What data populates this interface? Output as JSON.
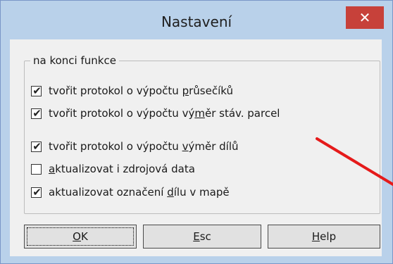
{
  "dialog": {
    "title": "Nastavení",
    "close_symbol": "✕",
    "group_label": "na konci funkce",
    "options": [
      {
        "pre": "tvořit protokol o výpočtu ",
        "key": "p",
        "post": "růsečíků",
        "checked": true
      },
      {
        "pre": "tvořit protokol o výpočtu vý",
        "key": "m",
        "post": "ěr stáv. parcel",
        "checked": true
      },
      {
        "pre": "tvořit protokol o výpočtu ",
        "key": "v",
        "post": "ýměr dílů",
        "checked": true
      },
      {
        "pre": "",
        "key": "a",
        "post": "ktualizovat i zdrojová data",
        "checked": false
      },
      {
        "pre": "aktualizovat označení ",
        "key": "d",
        "post": "ílu v mapě",
        "checked": true
      }
    ],
    "check_symbol": "✔",
    "buttons": {
      "ok": {
        "key": "O",
        "rest": "K"
      },
      "esc": {
        "key": "E",
        "rest": "sc"
      },
      "help": {
        "key": "H",
        "rest": "elp"
      }
    }
  },
  "colors": {
    "titlebar": "#b9d1ea",
    "close_button": "#c7413a",
    "annotation_arrow": "#e51a1a"
  }
}
